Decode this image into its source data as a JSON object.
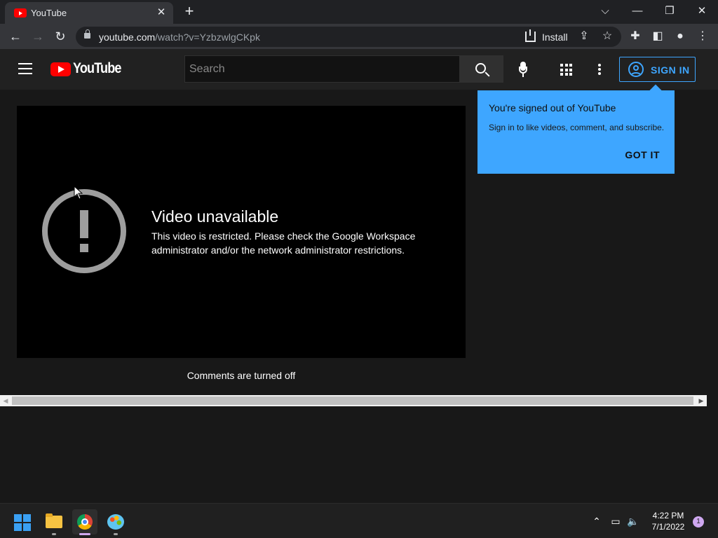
{
  "browser": {
    "tab_title": "YouTube",
    "tab_close": "✕",
    "new_tab": "+",
    "url_host": "youtube.com",
    "url_path": "/watch?v=YzbzwlgCKpk",
    "install_label": "Install",
    "window_controls": {
      "dropdown": "⌵",
      "minimize": "—",
      "restore": "❐",
      "close": "✕"
    }
  },
  "youtube": {
    "logo_text": "YouTube",
    "search_placeholder": "Search",
    "sign_in_label": "SIGN IN",
    "error": {
      "title": "Video unavailable",
      "message": "This video is restricted. Please check the Google Workspace administrator and/or the network administrator restrictions."
    },
    "comments_status": "Comments are turned off",
    "popup": {
      "title": "You're signed out of YouTube",
      "text": "Sign in to like videos, comment, and subscribe.",
      "button": "GOT IT"
    }
  },
  "taskbar": {
    "time": "4:22 PM",
    "date": "7/1/2022",
    "notification_count": "1",
    "apps": [
      "start-icon",
      "file-explorer-icon",
      "chrome-icon",
      "paint-icon"
    ]
  },
  "colors": {
    "accent_blue": "#3ea6ff",
    "youtube_red": "#ff0000",
    "page_bg": "#181818"
  }
}
